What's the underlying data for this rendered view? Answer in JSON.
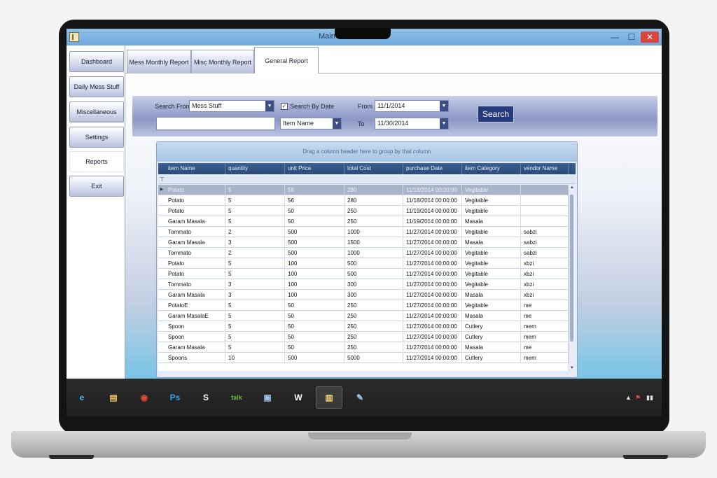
{
  "window": {
    "title": "MainWindow",
    "minimize": "—",
    "maximize": "☐",
    "close": "✕"
  },
  "sidebar": {
    "items": [
      {
        "label": "Dashboard"
      },
      {
        "label": "Daily Mess Stuff"
      },
      {
        "label": "Miscellaneous"
      },
      {
        "label": "Settings"
      },
      {
        "label": "Reports",
        "active": true
      },
      {
        "label": "Exit"
      }
    ]
  },
  "tabs": [
    {
      "label": "Mess Monthly Report"
    },
    {
      "label": "Misc Monthly Report"
    },
    {
      "label": "General Report",
      "active": true
    }
  ],
  "search": {
    "search_from_label": "Search From",
    "search_from_value": "Mess Stuff",
    "search_text_value": "",
    "search_by_date_label": "Search By Date",
    "search_by_date_checked": true,
    "field_value": "Item Name",
    "from_label": "From",
    "from_value": "11/1/2014",
    "to_label": "To",
    "to_value": "11/30/2014",
    "search_button": "Search"
  },
  "grid": {
    "group_hint": "Drag a column header here to group by that column",
    "columns": [
      "item Name",
      "quantity",
      "unit Price",
      "total Cost",
      "purchase Date",
      "item Category",
      "vendor Name"
    ],
    "rows": [
      [
        "Potato",
        "5",
        "56",
        "280",
        "11/18/2014 00:00:00",
        "Vegitable",
        ""
      ],
      [
        "Potato",
        "5",
        "56",
        "280",
        "11/18/2014 00:00:00",
        "Vegitable",
        ""
      ],
      [
        "Potato",
        "5",
        "50",
        "250",
        "11/19/2014 00:00:00",
        "Vegitable",
        ""
      ],
      [
        "Garam Masala",
        "5",
        "50",
        "250",
        "11/19/2014 00:00:00",
        "Masala",
        ""
      ],
      [
        "Tommato",
        "2",
        "500",
        "1000",
        "11/27/2014 00:00:00",
        "Vegitable",
        "sabzi"
      ],
      [
        "Garam Masala",
        "3",
        "500",
        "1500",
        "11/27/2014 00:00:00",
        "Masala",
        "sabzi"
      ],
      [
        "Tommato",
        "2",
        "500",
        "1000",
        "11/27/2014 00:00:00",
        "Vegitable",
        "sabzi"
      ],
      [
        "Potato",
        "5",
        "100",
        "500",
        "11/27/2014 00:00:00",
        "Vegitable",
        "xbzi"
      ],
      [
        "Potato",
        "5",
        "100",
        "500",
        "11/27/2014 00:00:00",
        "Vegitable",
        "xbzi"
      ],
      [
        "Tommato",
        "3",
        "100",
        "300",
        "11/27/2014 00:00:00",
        "Vegitable",
        "xbzi"
      ],
      [
        "Garam Masala",
        "3",
        "100",
        "300",
        "11/27/2014 00:00:00",
        "Masala",
        "xbzi"
      ],
      [
        "PotatoE",
        "5",
        "50",
        "250",
        "11/27/2014 00:00:00",
        "Vegitable",
        "me"
      ],
      [
        "Garam MasalaE",
        "5",
        "50",
        "250",
        "11/27/2014 00:00:00",
        "Masala",
        "me"
      ],
      [
        "Spoon",
        "5",
        "50",
        "250",
        "11/27/2014 00:00:00",
        "Cutlery",
        "mem"
      ],
      [
        "Spoon",
        "5",
        "50",
        "250",
        "11/27/2014 00:00:00",
        "Cutlery",
        "mem"
      ],
      [
        "Garam Masala",
        "5",
        "50",
        "250",
        "11/27/2014 00:00:00",
        "Masala",
        "me"
      ],
      [
        "Spoons",
        "10",
        "500",
        "5000",
        "11/27/2014 00:00:00",
        "Cutlery",
        "mem"
      ]
    ]
  },
  "taskbar": {
    "icons": [
      {
        "name": "ie-icon",
        "glyph": "e",
        "color": "#4fb3ef"
      },
      {
        "name": "file-explorer-icon",
        "glyph": "▤",
        "color": "#e8c15a"
      },
      {
        "name": "chrome-icon",
        "glyph": "◉",
        "color": "#e04a3c"
      },
      {
        "name": "photoshop-icon",
        "glyph": "Ps",
        "color": "#33a3f4"
      },
      {
        "name": "skype-icon",
        "glyph": "S",
        "color": "#ffffff"
      },
      {
        "name": "talk-icon",
        "glyph": "talk",
        "color": "#6bbf3a"
      },
      {
        "name": "virtualbox-icon",
        "glyph": "▣",
        "color": "#9fc3e8"
      },
      {
        "name": "word-icon",
        "glyph": "W",
        "color": "#ffffff"
      },
      {
        "name": "mess-app-icon",
        "glyph": "▥",
        "color": "#f1d37a"
      },
      {
        "name": "paint-icon",
        "glyph": "✎",
        "color": "#9fd0f0"
      }
    ],
    "tray": {
      "up_arrow": "▲",
      "flag": "⚑",
      "network": "▮▮"
    }
  },
  "colors": {
    "accent": "#253b7e",
    "grid_header": "#2b4a78",
    "close_button": "#d9453a"
  }
}
